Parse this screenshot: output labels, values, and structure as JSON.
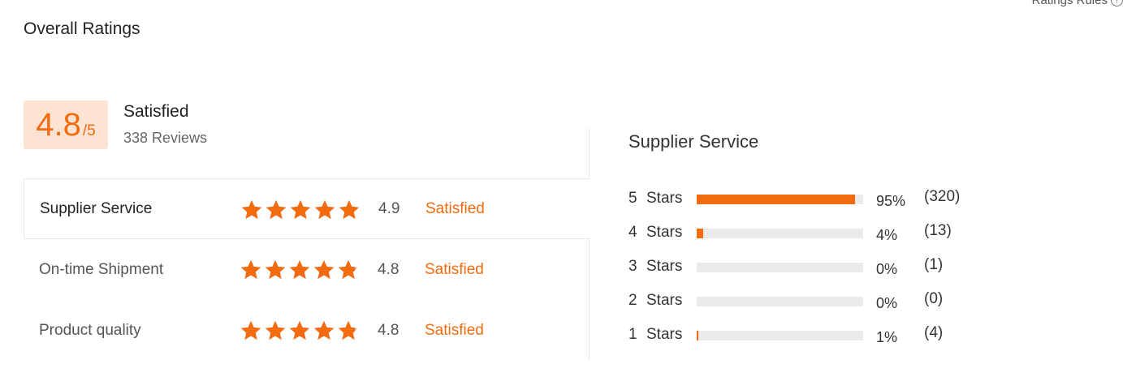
{
  "header": {
    "title": "Overall Ratings",
    "rules_label": "Ratings Rules",
    "rules_icon": "help-circle-icon"
  },
  "summary": {
    "score": "4.8",
    "out_of": "/5",
    "label": "Satisfied",
    "reviews": "338 Reviews"
  },
  "categories": [
    {
      "label": "Supplier Service",
      "value": "4.9",
      "status": "Satisfied",
      "rating": 4.9
    },
    {
      "label": "On-time Shipment",
      "value": "4.8",
      "status": "Satisfied",
      "rating": 4.8
    },
    {
      "label": "Product quality",
      "value": "4.8",
      "status": "Satisfied",
      "rating": 4.8
    }
  ],
  "distribution": {
    "title": "Supplier Service",
    "rows": [
      {
        "num": "5",
        "label": "Stars",
        "percent": "95%",
        "count": "(320)",
        "fraction": 0.95
      },
      {
        "num": "4",
        "label": "Stars",
        "percent": "4%",
        "count": "(13)",
        "fraction": 0.04
      },
      {
        "num": "3",
        "label": "Stars",
        "percent": "0%",
        "count": "(1)",
        "fraction": 0.0
      },
      {
        "num": "2",
        "label": "Stars",
        "percent": "0%",
        "count": "(0)",
        "fraction": 0.0
      },
      {
        "num": "1",
        "label": "Stars",
        "percent": "1%",
        "count": "(4)",
        "fraction": 0.01
      }
    ]
  },
  "colors": {
    "accent": "#f26b0f",
    "score_bg": "#fde3d2",
    "star_empty": "#d6d6d6",
    "track": "#ebebeb"
  }
}
